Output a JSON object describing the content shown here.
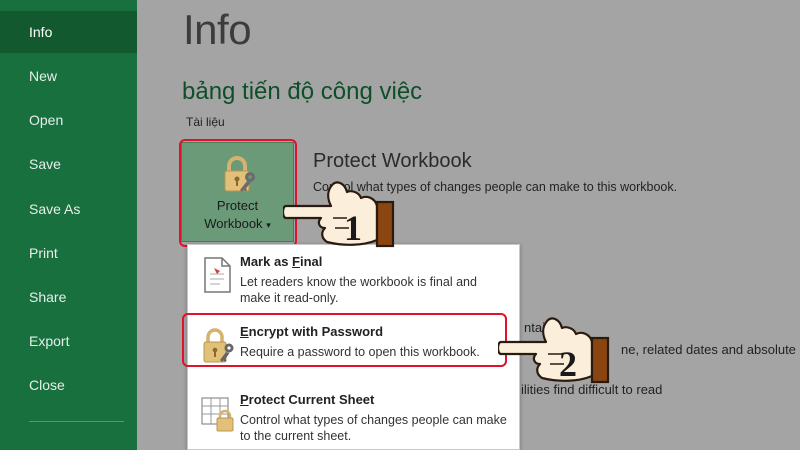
{
  "sidebar": {
    "items": [
      {
        "label": "Info",
        "active": true
      },
      {
        "label": "New"
      },
      {
        "label": "Open"
      },
      {
        "label": "Save"
      },
      {
        "label": "Save As"
      },
      {
        "label": "Print"
      },
      {
        "label": "Share"
      },
      {
        "label": "Export"
      },
      {
        "label": "Close"
      }
    ],
    "bg_color": "#18703f"
  },
  "main": {
    "title": "Info",
    "workbook_name": "bảng tiến độ công việc",
    "location": "Tài liệu",
    "protect_tile": {
      "line1": "Protect",
      "line2": "Workbook",
      "dropdown_arrow": "▾",
      "icon": "lock-key-icon"
    },
    "protect_heading": "Protect Workbook",
    "protect_desc": "Control what types of changes people can make to this workbook.",
    "partial_texts": {
      "contains": "ntains:",
      "dates": "ne, related dates and absolute",
      "read": "ilities find difficult to read"
    }
  },
  "dropdown": {
    "items": [
      {
        "title_pre": "Mark as ",
        "title_u": "F",
        "title_post": "inal",
        "desc": "Let readers know the workbook is final and make it read-only.",
        "icon": "document-final-icon"
      },
      {
        "title_pre": "",
        "title_u": "E",
        "title_post": "ncrypt with Password",
        "desc": "Require a password to open this workbook.",
        "icon": "lock-key-icon"
      },
      {
        "title_pre": "",
        "title_u": "P",
        "title_post": "rotect Current Sheet",
        "desc": "Control what types of changes people can make to the current sheet.",
        "icon": "sheet-lock-icon"
      }
    ]
  },
  "annotations": {
    "step1": "1",
    "step2": "2",
    "highlight_color": "#e0112a"
  }
}
